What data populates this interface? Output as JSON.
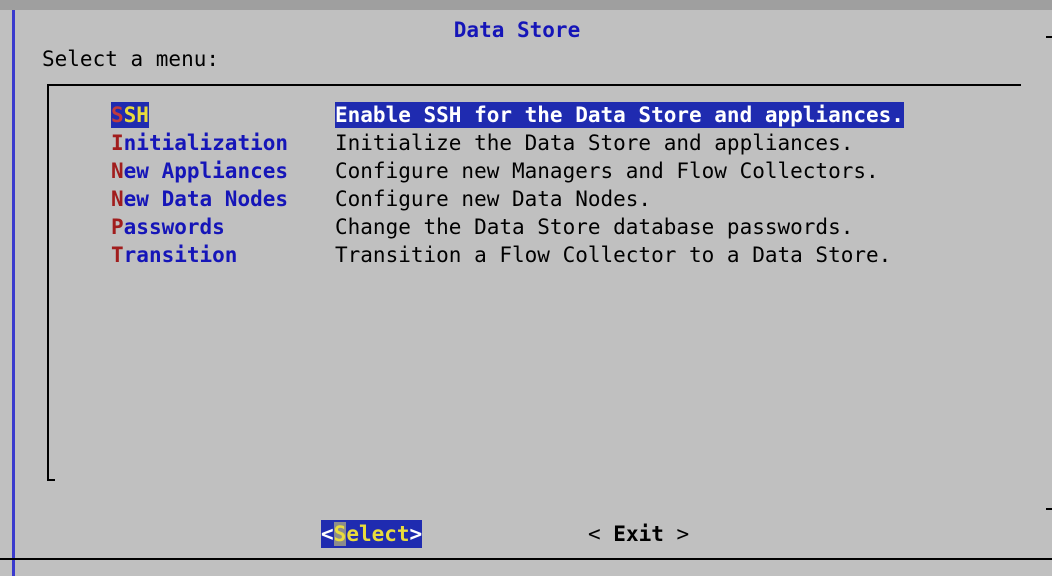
{
  "dialog": {
    "title": "Data Store",
    "prompt": "Select a menu:"
  },
  "menu": {
    "items": [
      {
        "hotkey": "S",
        "rest": "SH",
        "description": "Enable SSH for the Data Store and appliances.",
        "selected": true
      },
      {
        "hotkey": "I",
        "rest": "nitialization",
        "description": "Initialize the Data Store and appliances.",
        "selected": false
      },
      {
        "hotkey": "N",
        "rest": "ew Appliances",
        "description": "Configure new Managers and Flow Collectors.",
        "selected": false
      },
      {
        "hotkey": "N",
        "rest": "ew Data Nodes",
        "description": "Configure new Data Nodes.",
        "selected": false
      },
      {
        "hotkey": "P",
        "rest": "asswords",
        "description": "Change the Data Store database passwords.",
        "selected": false
      },
      {
        "hotkey": "T",
        "rest": "ransition",
        "description": "Transition a Flow Collector to a Data Store.",
        "selected": false
      }
    ]
  },
  "buttons": {
    "select": {
      "open": "<",
      "hotkey": "S",
      "rest": "elect",
      "close": ">"
    },
    "exit": {
      "open": "< ",
      "label": "Exit",
      "close": " >"
    }
  },
  "colors": {
    "background": "#c0c0c0",
    "title": "#1515b8",
    "hotkey": "#a11d1d",
    "selection_bg": "#1f2bb0",
    "selection_fg": "#ffffff",
    "selection_tag": "#e9dc3c"
  }
}
